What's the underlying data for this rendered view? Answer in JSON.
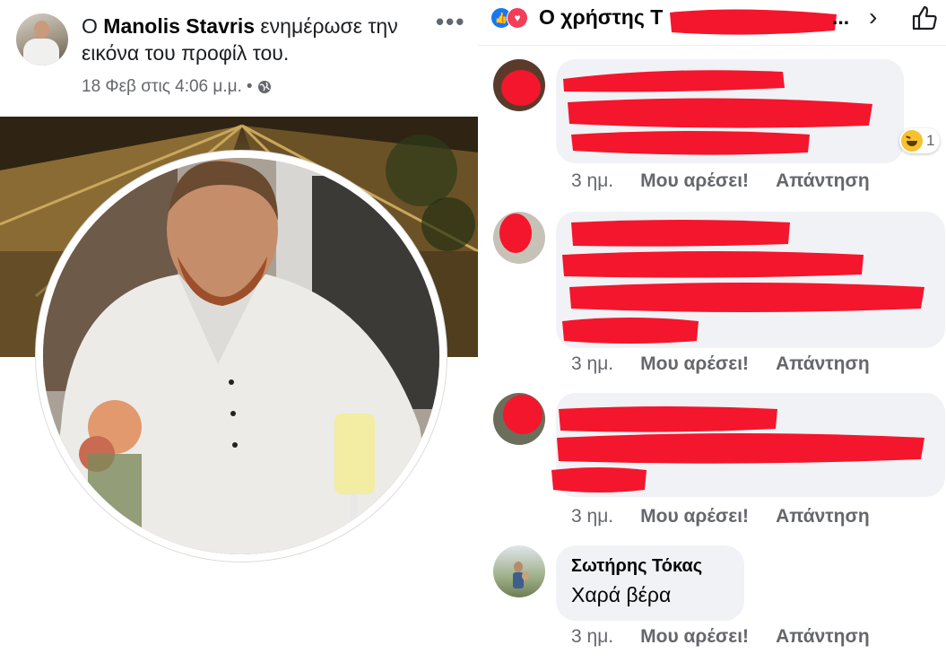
{
  "post": {
    "prefix": "Ο",
    "author": "Manolis Stavris",
    "action": "ενημέρωσε την εικόνα του προφίλ του.",
    "timestamp": "18 Φεβ στις 4:06 μ.μ.",
    "separator": "•",
    "privacy_icon": "globe-icon",
    "more_icon": "more-dots-icon",
    "more_label": "•••"
  },
  "header": {
    "title_visible": "Ο χρήστης Τ",
    "ellipsis": "...",
    "chevron": "›",
    "reactions": [
      "like-icon",
      "love-icon"
    ],
    "like_button_icon": "thumbs-up-icon"
  },
  "comments": [
    {
      "author": "",
      "text": "",
      "redacted": true,
      "time": "3 ημ.",
      "like_label": "Μου αρέσει!",
      "reply_label": "Απάντηση",
      "reaction_icon": "haha-icon",
      "reaction_count": "1"
    },
    {
      "author": "",
      "text": "",
      "redacted": true,
      "time": "3 ημ.",
      "like_label": "Μου αρέσει!",
      "reply_label": "Απάντηση"
    },
    {
      "author": "",
      "text": "",
      "redacted": true,
      "time": "3 ημ.",
      "like_label": "Μου αρέσει!",
      "reply_label": "Απάντηση"
    },
    {
      "author": "Σωτήρης Τόκας",
      "text": "Χαρά βέρα",
      "redacted": false,
      "time": "3 ημ.",
      "like_label": "Μου αρέσει!",
      "reply_label": "Απάντηση"
    }
  ],
  "colors": {
    "redaction": "#f4162c",
    "bubble": "#f0f2f5",
    "meta_text": "#65676b",
    "facebook_blue": "#1877f2"
  }
}
